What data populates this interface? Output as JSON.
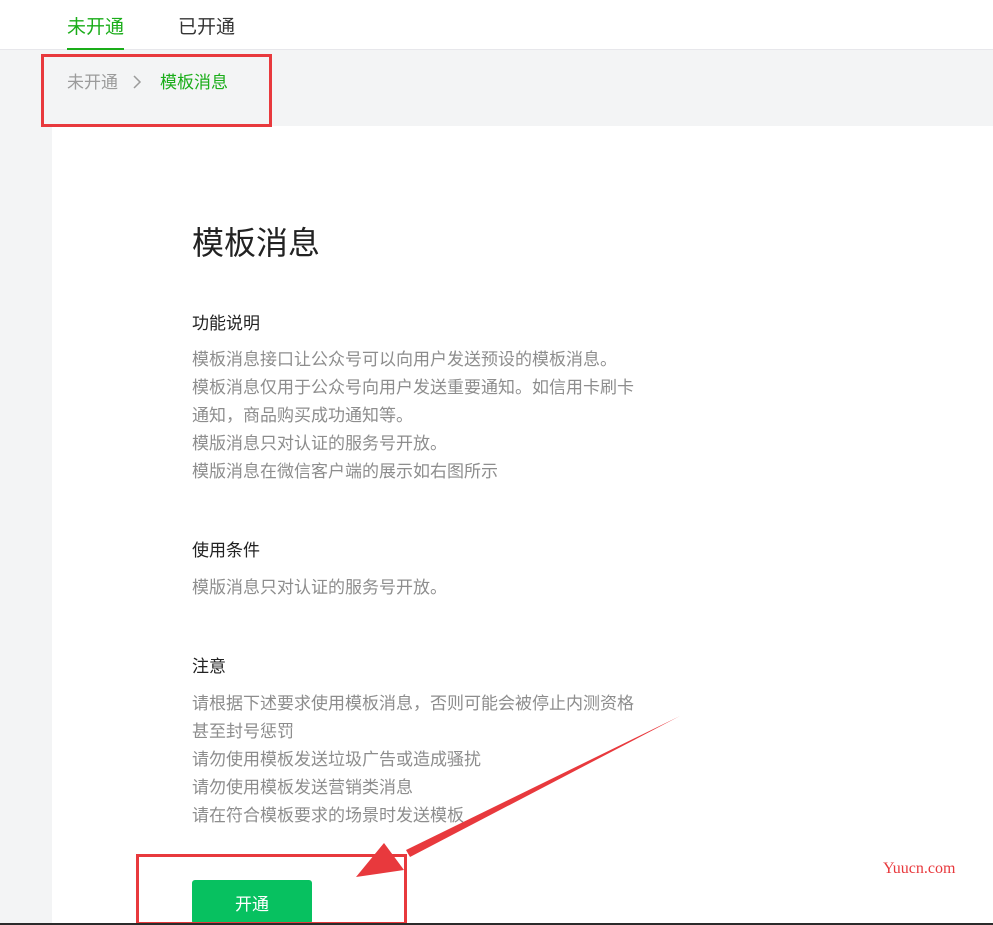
{
  "tabs": [
    {
      "label": "未开通",
      "active": true
    },
    {
      "label": "已开通",
      "active": false
    }
  ],
  "breadcrumb": {
    "parent": "未开通",
    "separator_icon": "chevron-right-icon",
    "current": "模板消息"
  },
  "main": {
    "title": "模板消息",
    "sections": [
      {
        "title": "功能说明",
        "lines": [
          "模板消息接口让公众号可以向用户发送预设的模板消息。",
          "模板消息仅用于公众号向用户发送重要通知。如信用卡刷卡",
          "通知，商品购买成功通知等。",
          "模版消息只对认证的服务号开放。",
          "模版消息在微信客户端的展示如右图所示"
        ]
      },
      {
        "title": "使用条件",
        "lines": [
          "模版消息只对认证的服务号开放。"
        ]
      },
      {
        "title": "注意",
        "lines": [
          "请根据下述要求使用模板消息，否则可能会被停止内测资格",
          "甚至封号惩罚",
          "请勿使用模板发送垃圾广告或造成骚扰",
          "请勿使用模板发送营销类消息",
          "请在符合模板要求的场景时发送模板"
        ]
      }
    ],
    "open_button_label": "开通"
  },
  "watermark": "Yuucn.com",
  "colors": {
    "accent_green": "#1aad19",
    "button_green": "#07c160",
    "annotation_red": "#e8393d"
  }
}
